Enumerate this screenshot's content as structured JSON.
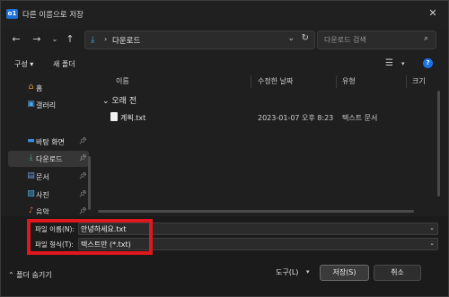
{
  "window": {
    "title": "다른 이름으로 저장",
    "app_icon_text": "o1"
  },
  "nav": {
    "address_segment": "다운로드",
    "search_placeholder": "다운로드 검색"
  },
  "toolbar": {
    "organize_label": "구성",
    "new_folder_label": "새 폴더"
  },
  "sidebar": {
    "items": [
      {
        "label": "홈",
        "icon": "home-icon",
        "pinned": false
      },
      {
        "label": "갤러리",
        "icon": "gallery-icon",
        "pinned": false
      },
      {
        "label": "바탕 화면",
        "icon": "desktop-icon",
        "pinned": true
      },
      {
        "label": "다운로드",
        "icon": "download-icon",
        "pinned": true,
        "selected": true
      },
      {
        "label": "문서",
        "icon": "document-icon",
        "pinned": true
      },
      {
        "label": "사진",
        "icon": "picture-icon",
        "pinned": true
      },
      {
        "label": "음악",
        "icon": "music-icon",
        "pinned": true
      }
    ]
  },
  "filelist": {
    "columns": [
      "이름",
      "수정한 날짜",
      "유형",
      "크기"
    ],
    "group_label": "오래 전",
    "files": [
      {
        "name": "계획.txt",
        "modified": "2023-01-07 오후 8:23",
        "type": "텍스트 문서"
      }
    ]
  },
  "save_form": {
    "filename_label": "파일 이름(N):",
    "filename_value": "안녕하세요.txt",
    "filetype_label": "파일 형식(T):",
    "filetype_value": "텍스트만 (*.txt)"
  },
  "footer": {
    "hide_folders_label": "폴더 숨기기",
    "tools_label": "도구(L)",
    "save_label": "저장(S)",
    "cancel_label": "취소"
  },
  "colors": {
    "highlight": "#e0171d",
    "accent": "#1a73e8"
  }
}
